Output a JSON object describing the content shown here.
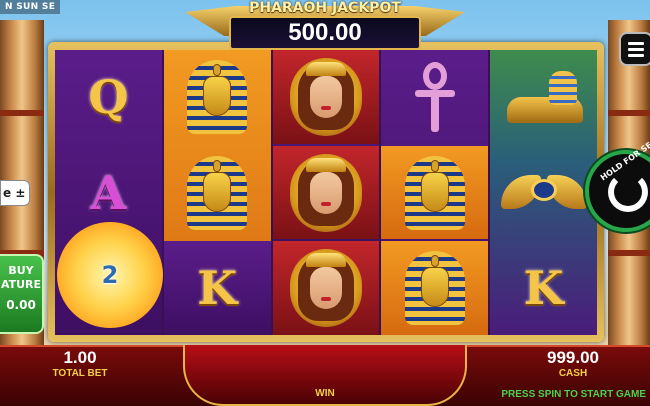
{
  "game": {
    "title_fragment": "N SUN SE"
  },
  "jackpot": {
    "title": "PHARAOH JACKPOT",
    "amount": "500.00"
  },
  "reels": [
    [
      "queen-card",
      "ace-card",
      "sun-bonus"
    ],
    [
      "pharaoh",
      "pharaoh",
      "king-card"
    ],
    [
      "cleopatra",
      "cleopatra",
      "cleopatra"
    ],
    [
      "ankh",
      "pharaoh",
      "pharaoh"
    ],
    [
      "sphinx",
      "eye-of-horus",
      "king-card"
    ]
  ],
  "symbols": {
    "queen": "Q",
    "ace": "A",
    "king": "K"
  },
  "sun_bonus": {
    "value": "2"
  },
  "controls": {
    "bet_toggle": "e ±",
    "buy_feature_line1": "BUY",
    "buy_feature_line2": "ATURE",
    "buy_feature_price": "0.00",
    "spin_hint": "HOLD FOR SE"
  },
  "bottom": {
    "total_bet_value": "1.00",
    "total_bet_label": "TOTAL BET",
    "win_label": "WIN",
    "cash_value": "999.00",
    "cash_label": "CASH",
    "status": "PRESS SPIN TO START GAME"
  },
  "colors": {
    "frame_gold": "#e6c15e",
    "reel_purple": "#5b1d8a",
    "reel_orange": "#f29a22",
    "cleopatra_red": "#c2262b",
    "spin_green": "#27a64a",
    "status_green": "#4bd24b",
    "label_gold": "#f3d04a"
  }
}
